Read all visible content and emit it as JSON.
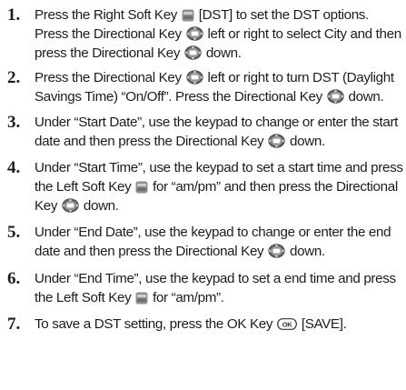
{
  "steps": [
    {
      "num": "1.",
      "segments": [
        {
          "t": "Press the Right Soft Key "
        },
        {
          "icon": "soft-key-icon"
        },
        {
          "t": " [DST] to set the DST options. Press the Directional Key "
        },
        {
          "icon": "directional-key-icon"
        },
        {
          "t": " left or right to select City and then press the Directional Key "
        },
        {
          "icon": "directional-key-icon"
        },
        {
          "t": " down."
        }
      ]
    },
    {
      "num": "2.",
      "segments": [
        {
          "t": "Press the Directional Key "
        },
        {
          "icon": "directional-key-icon"
        },
        {
          "t": " left or right to turn DST (Daylight Savings Time) “On/Off”. Press the Directional Key "
        },
        {
          "icon": "directional-key-icon"
        },
        {
          "t": " down."
        }
      ]
    },
    {
      "num": "3.",
      "segments": [
        {
          "t": "Under “Start Date”, use the keypad to change or enter the start date and then press the Directional Key "
        },
        {
          "icon": "directional-key-icon"
        },
        {
          "t": " down."
        }
      ]
    },
    {
      "num": "4.",
      "segments": [
        {
          "t": "Under “Start Time”, use the keypad to set a start time and press the Left Soft Key "
        },
        {
          "icon": "soft-key-icon"
        },
        {
          "t": " for “am/pm” and then press the Directional Key "
        },
        {
          "icon": "directional-key-icon"
        },
        {
          "t": " down."
        }
      ]
    },
    {
      "num": "5.",
      "segments": [
        {
          "t": "Under “End Date”, use the keypad to change or enter the end date and then press the Directional Key "
        },
        {
          "icon": "directional-key-icon"
        },
        {
          "t": " down."
        }
      ]
    },
    {
      "num": "6.",
      "segments": [
        {
          "t": "Under “End Time”, use the keypad to set a end time and press the Left Soft Key "
        },
        {
          "icon": "soft-key-icon"
        },
        {
          "t": " for “am/pm”."
        }
      ]
    },
    {
      "num": "7.",
      "segments": [
        {
          "t": "To save a DST setting, press the OK Key "
        },
        {
          "icon": "ok-key-icon"
        },
        {
          "t": " [SAVE]."
        }
      ]
    }
  ],
  "ok_key_label": "OK"
}
